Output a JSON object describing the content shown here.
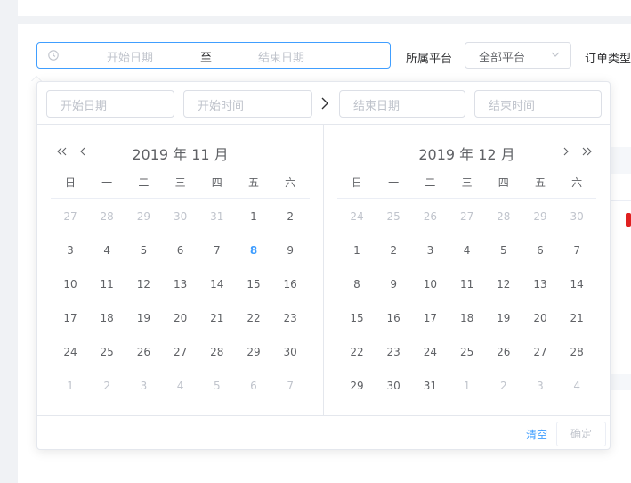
{
  "range_picker": {
    "start_placeholder": "开始日期",
    "separator": "至",
    "end_placeholder": "结束日期"
  },
  "filters": {
    "platform_label": "所属平台",
    "platform_value": "全部平台",
    "order_type_label": "订单类型"
  },
  "popper": {
    "start_date_placeholder": "开始日期",
    "start_time_placeholder": "开始时间",
    "end_date_placeholder": "结束日期",
    "end_time_placeholder": "结束时间",
    "clear_label": "清空",
    "confirm_label": "确定"
  },
  "weekdays": [
    "日",
    "一",
    "二",
    "三",
    "四",
    "五",
    "六"
  ],
  "left_calendar": {
    "title": "2019 年 11 月",
    "rows": [
      [
        {
          "d": "27",
          "o": true
        },
        {
          "d": "28",
          "o": true
        },
        {
          "d": "29",
          "o": true
        },
        {
          "d": "30",
          "o": true
        },
        {
          "d": "31",
          "o": true
        },
        {
          "d": "1"
        },
        {
          "d": "2"
        }
      ],
      [
        {
          "d": "3"
        },
        {
          "d": "4"
        },
        {
          "d": "5"
        },
        {
          "d": "6"
        },
        {
          "d": "7"
        },
        {
          "d": "8",
          "t": true
        },
        {
          "d": "9"
        }
      ],
      [
        {
          "d": "10"
        },
        {
          "d": "11"
        },
        {
          "d": "12"
        },
        {
          "d": "13"
        },
        {
          "d": "14"
        },
        {
          "d": "15"
        },
        {
          "d": "16"
        }
      ],
      [
        {
          "d": "17"
        },
        {
          "d": "18"
        },
        {
          "d": "19"
        },
        {
          "d": "20"
        },
        {
          "d": "21"
        },
        {
          "d": "22"
        },
        {
          "d": "23"
        }
      ],
      [
        {
          "d": "24"
        },
        {
          "d": "25"
        },
        {
          "d": "26"
        },
        {
          "d": "27"
        },
        {
          "d": "28"
        },
        {
          "d": "29"
        },
        {
          "d": "30"
        }
      ],
      [
        {
          "d": "1",
          "o": true
        },
        {
          "d": "2",
          "o": true
        },
        {
          "d": "3",
          "o": true
        },
        {
          "d": "4",
          "o": true
        },
        {
          "d": "5",
          "o": true
        },
        {
          "d": "6",
          "o": true
        },
        {
          "d": "7",
          "o": true
        }
      ]
    ]
  },
  "right_calendar": {
    "title": "2019 年 12 月",
    "rows": [
      [
        {
          "d": "24",
          "o": true
        },
        {
          "d": "25",
          "o": true
        },
        {
          "d": "26",
          "o": true
        },
        {
          "d": "27",
          "o": true
        },
        {
          "d": "28",
          "o": true
        },
        {
          "d": "29",
          "o": true
        },
        {
          "d": "30",
          "o": true
        }
      ],
      [
        {
          "d": "1"
        },
        {
          "d": "2"
        },
        {
          "d": "3"
        },
        {
          "d": "4"
        },
        {
          "d": "5"
        },
        {
          "d": "6"
        },
        {
          "d": "7"
        }
      ],
      [
        {
          "d": "8"
        },
        {
          "d": "9"
        },
        {
          "d": "10"
        },
        {
          "d": "11"
        },
        {
          "d": "12"
        },
        {
          "d": "13"
        },
        {
          "d": "14"
        }
      ],
      [
        {
          "d": "15"
        },
        {
          "d": "16"
        },
        {
          "d": "17"
        },
        {
          "d": "18"
        },
        {
          "d": "19"
        },
        {
          "d": "20"
        },
        {
          "d": "21"
        }
      ],
      [
        {
          "d": "22"
        },
        {
          "d": "23"
        },
        {
          "d": "24"
        },
        {
          "d": "25"
        },
        {
          "d": "26"
        },
        {
          "d": "27"
        },
        {
          "d": "28"
        }
      ],
      [
        {
          "d": "29"
        },
        {
          "d": "30"
        },
        {
          "d": "31"
        },
        {
          "d": "1",
          "o": true
        },
        {
          "d": "2",
          "o": true
        },
        {
          "d": "3",
          "o": true
        },
        {
          "d": "4",
          "o": true
        }
      ]
    ]
  },
  "colors": {
    "accent": "#409eff",
    "hint_red": "#e02020"
  }
}
